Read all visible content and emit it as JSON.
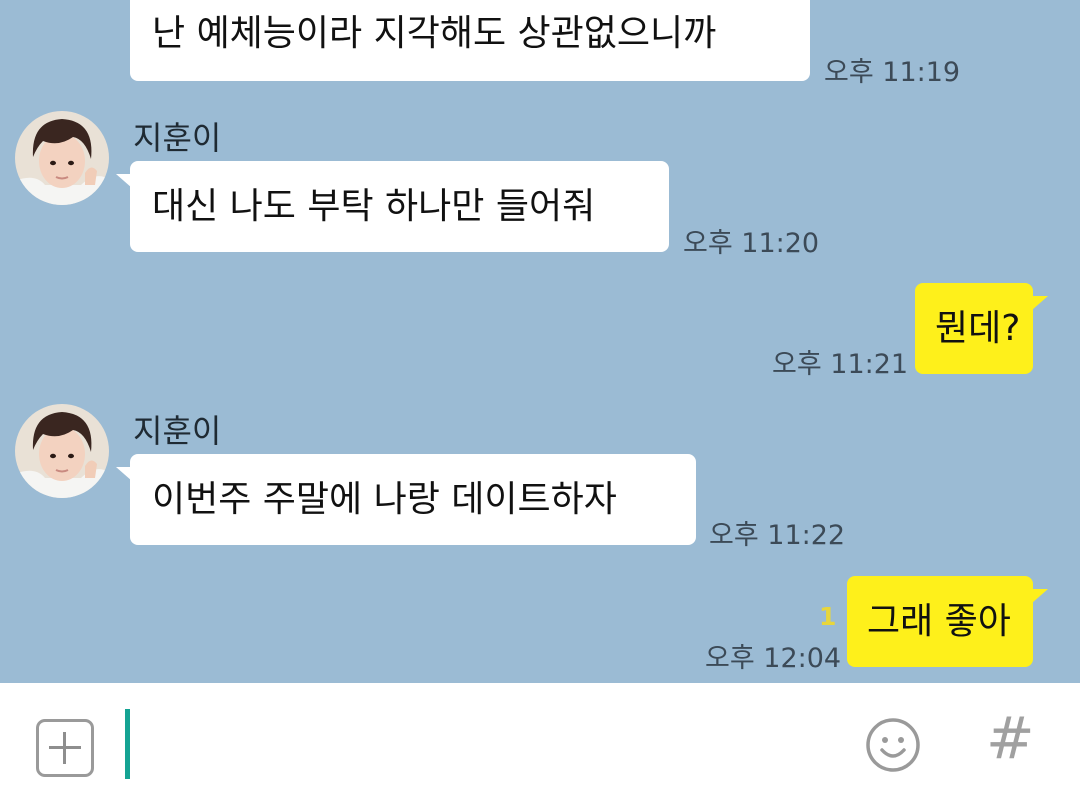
{
  "messages": [
    {
      "direction": "in",
      "text": "난 예체능이라 지각해도 상관없으니까",
      "time": "오후 11:19"
    },
    {
      "direction": "in",
      "sender": "지훈이",
      "text": "대신 나도 부탁 하나만 들어줘",
      "time": "오후 11:20"
    },
    {
      "direction": "out",
      "text": "뭔데?",
      "time": "오후 11:21"
    },
    {
      "direction": "in",
      "sender": "지훈이",
      "text": "이번주 주말에 나랑 데이트하자",
      "time": "오후 11:22"
    },
    {
      "direction": "out",
      "text": "그래 좋아",
      "time": "오후 12:04",
      "unread": "1"
    }
  ],
  "input_bar": {
    "placeholder": "",
    "plus_icon": "plus-square-icon",
    "emoji_icon": "smiley-icon",
    "hash_icon": "hash-icon",
    "hash_glyph": "#"
  },
  "colors": {
    "chat_bg": "#9bbbd4",
    "incoming_bubble": "#ffffff",
    "outgoing_bubble": "#fef01b",
    "cursor": "#14a393"
  }
}
